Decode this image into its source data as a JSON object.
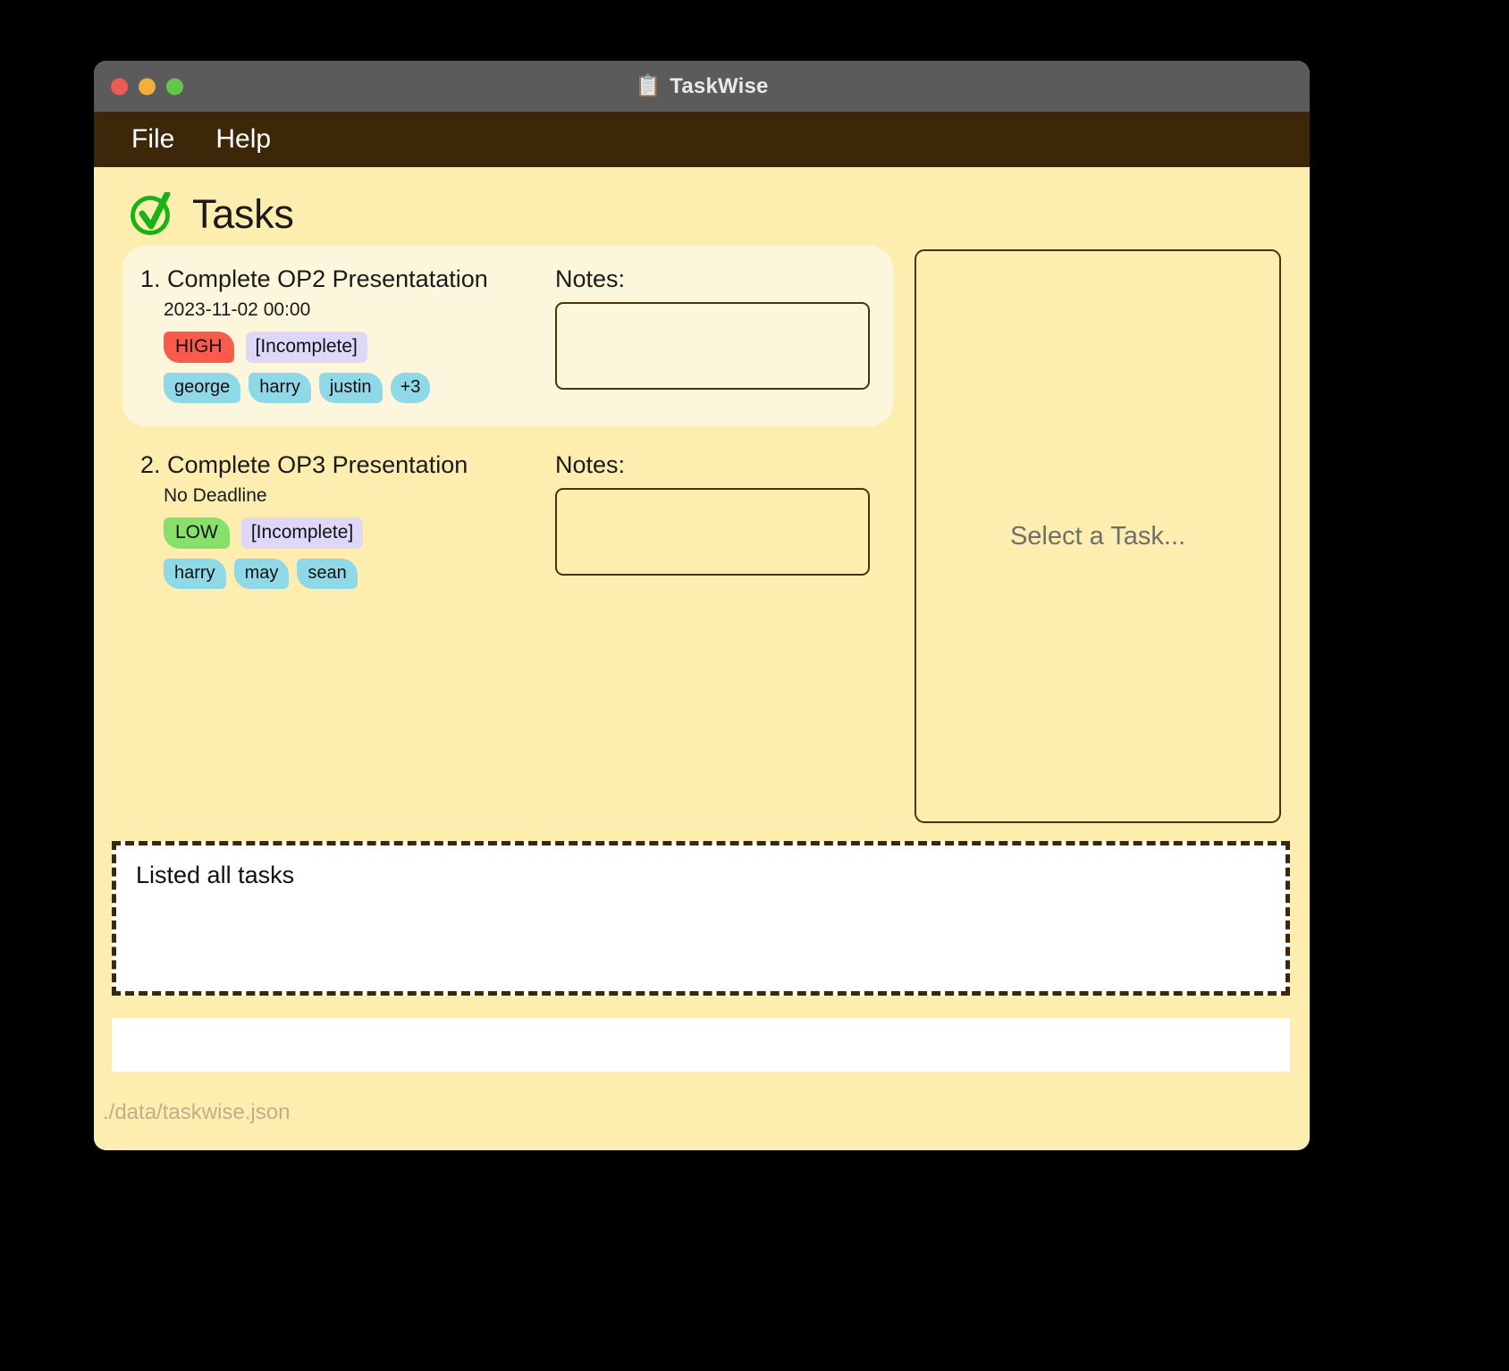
{
  "window": {
    "title": "TaskWise",
    "title_icon": "clipboard-checklist-icon",
    "traffic_lights": [
      "close",
      "minimize",
      "maximize"
    ]
  },
  "menubar": {
    "items": [
      {
        "label": "File"
      },
      {
        "label": "Help"
      }
    ]
  },
  "page": {
    "heading": "Tasks",
    "heading_icon": "green-check-circle-icon"
  },
  "tasks": [
    {
      "index_label": "1.",
      "title": "Complete OP2 Presentatation",
      "deadline": "2023-11-02 00:00",
      "priority": "HIGH",
      "priority_color": "#fb5a4c",
      "status": "[Incomplete]",
      "status_color": "#ded7f7",
      "assignees": [
        "george",
        "harry",
        "justin"
      ],
      "assignee_overflow": "+3",
      "selected": true,
      "notes_label": "Notes:",
      "notes_value": "",
      "notes_placeholder": ""
    },
    {
      "index_label": "2.",
      "title": "Complete OP3 Presentation",
      "deadline": "No Deadline",
      "priority": "LOW",
      "priority_color": "#86e06a",
      "status": "[Incomplete]",
      "status_color": "#ded7f7",
      "assignees": [
        "harry",
        "may",
        "sean"
      ],
      "assignee_overflow": "",
      "selected": false,
      "notes_label": "Notes:",
      "notes_value": "",
      "notes_placeholder": ""
    }
  ],
  "detail_panel": {
    "placeholder": "Select a Task..."
  },
  "log": {
    "message": "Listed all tasks"
  },
  "command": {
    "value": "",
    "placeholder": ""
  },
  "footer": {
    "file_path": "./data/taskwise.json"
  },
  "colors": {
    "window_bg": "#fdeeb0",
    "titlebar_bg": "#5b5b5b",
    "menubar_bg": "#3c2708",
    "accent_border": "#4a3305",
    "chip_bg": "#8fd8e8",
    "selected_card_bg": "#fcf6dc"
  }
}
